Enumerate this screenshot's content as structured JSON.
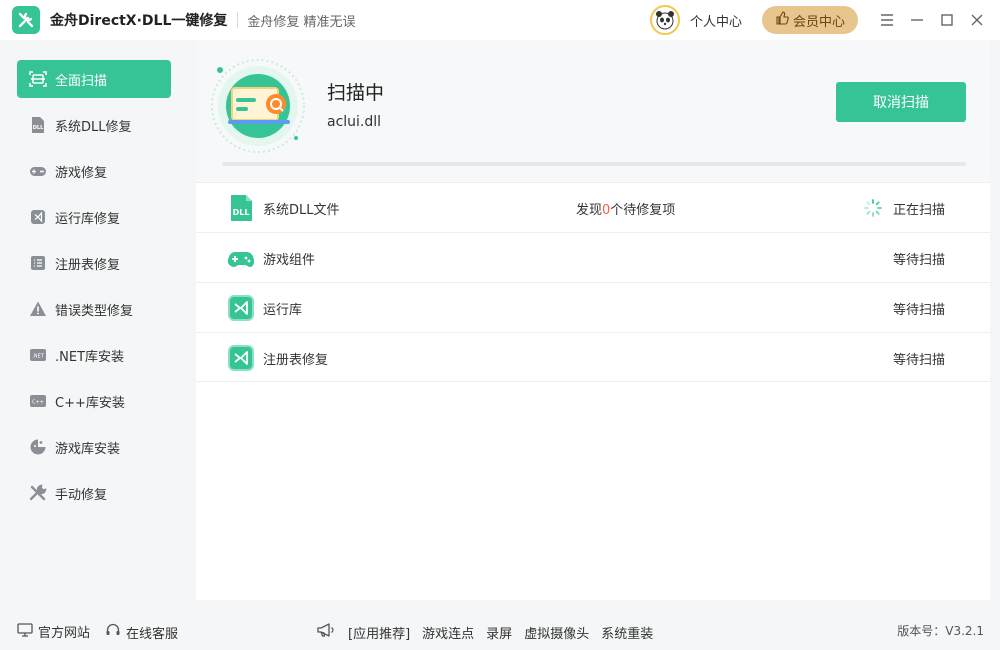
{
  "app": {
    "title": "金舟DirectX·DLL一键修复",
    "slogan": "金舟修复 精准无误"
  },
  "header": {
    "user_center": "个人中心",
    "vip_label": "会员中心"
  },
  "sidebar": {
    "items": [
      {
        "label": "全面扫描",
        "icon": "scan-icon",
        "active": true
      },
      {
        "label": "系统DLL修复",
        "icon": "dll-icon"
      },
      {
        "label": "游戏修复",
        "icon": "gamepad-icon"
      },
      {
        "label": "运行库修复",
        "icon": "runtime-icon"
      },
      {
        "label": "注册表修复",
        "icon": "registry-icon"
      },
      {
        "label": "错误类型修复",
        "icon": "warning-icon"
      },
      {
        "label": ".NET库安装",
        "icon": "dotnet-icon"
      },
      {
        "label": "C++库安装",
        "icon": "cpp-icon"
      },
      {
        "label": "游戏库安装",
        "icon": "game-lib-icon"
      },
      {
        "label": "手动修复",
        "icon": "tools-icon"
      }
    ]
  },
  "scan": {
    "status": "扫描中",
    "current_file": "aclui.dll",
    "cancel_label": "取消扫描",
    "progress": 0.0
  },
  "scan_items": [
    {
      "label": "系统DLL文件",
      "found_prefix": "发现",
      "found_count": "0",
      "found_suffix": "个待修复项",
      "state": "正在扫描"
    },
    {
      "label": "游戏组件",
      "state": "等待扫描"
    },
    {
      "label": "运行库",
      "state": "等待扫描"
    },
    {
      "label": "注册表修复",
      "state": "等待扫描"
    }
  ],
  "footer": {
    "official_site": "官方网站",
    "online_service": "在线客服",
    "recommend_label": "[应用推荐]",
    "recommend_links": [
      "游戏连点",
      "录屏",
      "虚拟摄像头",
      "系统重装"
    ],
    "version": "版本号：V3.2.1"
  },
  "colors": {
    "accent": "#36c497",
    "vip": "#e9c58e",
    "highlight": "#ff5b3b"
  }
}
